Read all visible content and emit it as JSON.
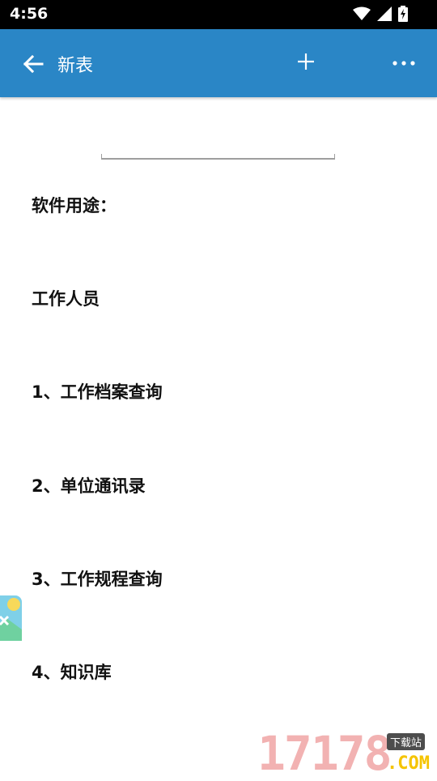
{
  "status_bar": {
    "time": "4:56",
    "icons": [
      "wifi-icon",
      "signal-icon",
      "battery-charging-icon"
    ]
  },
  "app_bar": {
    "title": "新表",
    "icons": [
      "back-arrow-icon",
      "plus-icon",
      "more-horizontal-icon"
    ],
    "color": "#2a86c6"
  },
  "document": {
    "lines": [
      "软件用途：",
      "工作人员",
      "1、工作档案查询",
      "2、单位通讯录",
      "3、工作规程查询",
      "4、知识库"
    ]
  },
  "watermark": {
    "digits": "17178",
    "badge": "下载站",
    "suffix": ".COM"
  }
}
